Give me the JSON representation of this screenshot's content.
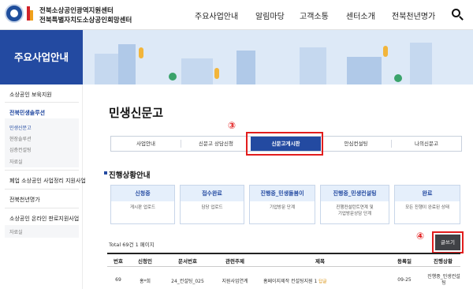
{
  "header": {
    "org_line1": "전북소상공인광역지원센터",
    "org_line2": "전북특별자치도소상공인희망센터",
    "logo_text": "전북",
    "nav": [
      "주요사업안내",
      "알림마당",
      "고객소통",
      "센터소개",
      "전북천년명가"
    ],
    "search_icon": "search-icon"
  },
  "banner": {
    "title": "주요사업안내"
  },
  "sidebar": {
    "items": [
      {
        "label": "소상공인 보육지원"
      },
      {
        "label": "전북민생솔루션"
      },
      {
        "label": "폐업 소상공인 사업정리 지원사업"
      },
      {
        "label": "전북천년명가"
      },
      {
        "label": "소상공인 온라인 판로지원사업"
      }
    ],
    "subitems": [
      "민생신문고",
      "현장솔루션",
      "심층컨설팅",
      "자료실"
    ],
    "subitems2": [
      "자료실"
    ]
  },
  "main": {
    "title": "민생신문고",
    "tabs": [
      "사업안내",
      "신문고 상담신청",
      "신문고게시판",
      "안심컨설팅",
      "나의신문고"
    ],
    "active_tab": "신문고게시판",
    "markers": {
      "tab": "③",
      "write": "④"
    },
    "section_title": "진행상황안내",
    "stages": [
      {
        "title": "신청중",
        "desc": "게시판 업로드"
      },
      {
        "title": "접수완료",
        "desc": "담당 업로드"
      },
      {
        "title": "진행중_민생돌봄이",
        "desc": "기업방문 단계"
      },
      {
        "title": "진행중_민생컨설팅",
        "desc": "진행컨설턴트연계 및\n기업방문상담 단계"
      },
      {
        "title": "완료",
        "desc": "모든 진행이 완료된 상태"
      }
    ],
    "total_text": "Total 69건 1 페이지",
    "write_button": "글쓰기",
    "table": {
      "headers": [
        "번호",
        "신청인",
        "문서번호",
        "관련주제",
        "제목",
        "등록일",
        "진행상황"
      ],
      "rows": [
        {
          "no": "69",
          "applicant": "홍*희",
          "doc_no": "24_컨설팅_025",
          "topic": "지원사업연계",
          "subject": "홈페이지제작 컨설팅지원 1",
          "badge": "답글",
          "date": "09-25",
          "status_line1": "진행중_민생컨설",
          "status_line2": "팅"
        }
      ]
    }
  },
  "colors": {
    "primary": "#234aa1",
    "highlight": "#e21d1d",
    "stage_bg": "#e5effb"
  }
}
